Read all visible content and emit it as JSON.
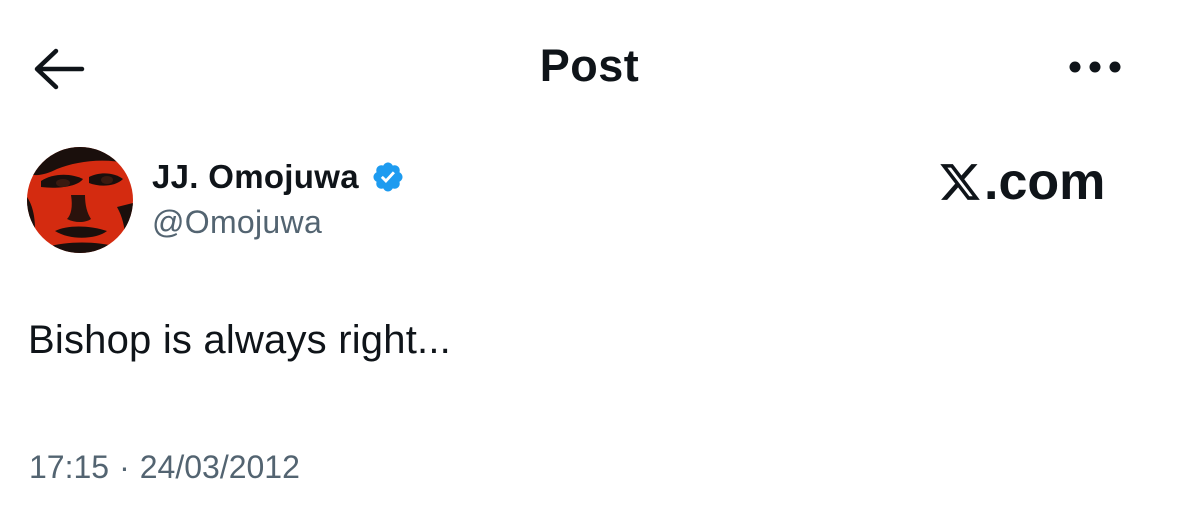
{
  "header": {
    "back_icon": "arrow-left-icon",
    "title": "Post",
    "more_icon": "more-horizontal-icon"
  },
  "author": {
    "name": "JJ. Omojuwa",
    "handle": "@Omojuwa",
    "verified_icon": "verified-badge-icon",
    "verified_color": "#1d9bf0",
    "avatar_color": "#d42b10"
  },
  "brand": {
    "logo_text": ".com",
    "logo_icon": "x-logo-icon"
  },
  "post": {
    "text": "Bishop is always right...",
    "time": "17:15",
    "separator": "·",
    "date": "24/03/2012"
  }
}
